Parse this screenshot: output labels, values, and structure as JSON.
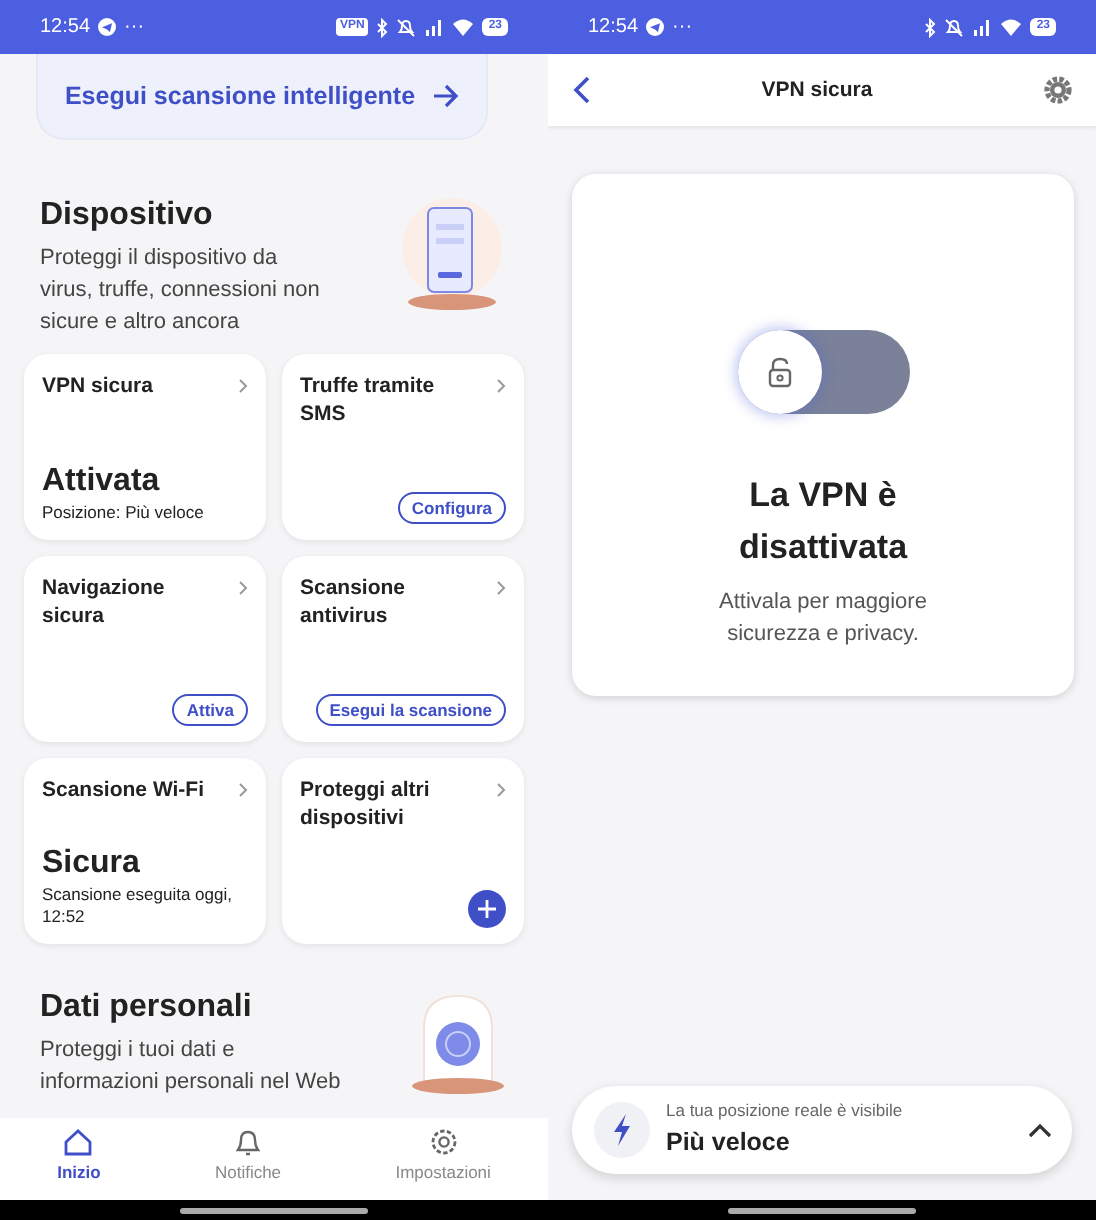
{
  "left_screen": {
    "status_bar": {
      "time": "12:54",
      "more": "···",
      "vpn_badge": "VPN",
      "battery": "23"
    },
    "smart_scan_button": "Esegui scansione intelligente",
    "device_section": {
      "title": "Dispositivo",
      "description": "Proteggi il dispositivo da virus, truffe, connessioni non sicure e altro ancora"
    },
    "cards": [
      {
        "kind": "status",
        "title": "VPN sicura",
        "status": "Attivata",
        "detail": "Posizione: Più veloce"
      },
      {
        "kind": "action",
        "title": "Truffe tramite SMS",
        "action": "Configura"
      },
      {
        "kind": "action",
        "title": "Navigazione sicura",
        "action": "Attiva"
      },
      {
        "kind": "action",
        "title": "Scansione antivirus",
        "action": "Esegui la scansione"
      },
      {
        "kind": "status",
        "title": "Scansione Wi-Fi",
        "status": "Sicura",
        "detail": "Scansione eseguita oggi,  12:52"
      },
      {
        "kind": "add",
        "title": "Proteggi altri dispositivi"
      }
    ],
    "personal_section": {
      "title": "Dati personali",
      "description": "Proteggi i tuoi dati e informazioni personali nel Web"
    },
    "bottom_nav": [
      {
        "label": "Inizio",
        "selected": true
      },
      {
        "label": "Notifiche",
        "selected": false
      },
      {
        "label": "Impostazioni",
        "selected": false
      }
    ]
  },
  "right_screen": {
    "status_bar": {
      "time": "12:54",
      "more": "···",
      "battery": "23"
    },
    "header": {
      "title": "VPN sicura"
    },
    "vpn_card": {
      "on": false,
      "title": "La VPN è disattivata",
      "subtitle": "Attivala per maggiore sicurezza e privacy."
    },
    "location_bar": {
      "caption": "La tua posizione reale è visibile",
      "location": "Più veloce"
    }
  }
}
